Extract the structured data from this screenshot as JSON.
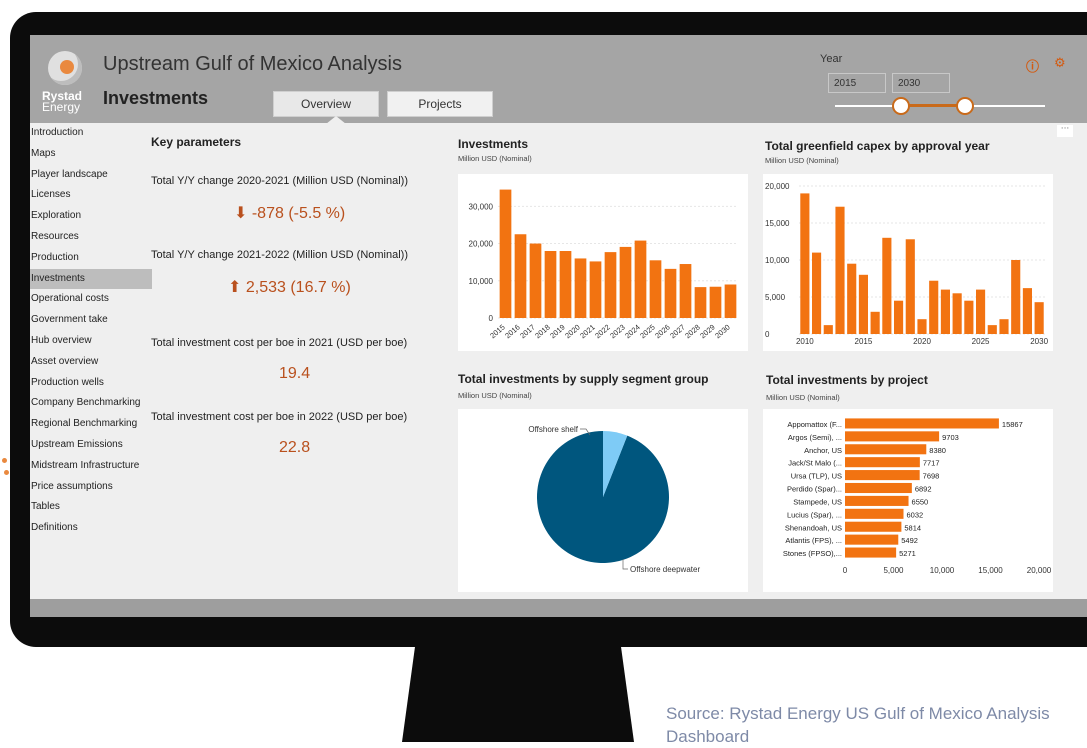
{
  "header": {
    "logo_top": "Rystad",
    "logo_bottom": "Energy",
    "app_title": "Upstream Gulf of Mexico Analysis",
    "page_title": "Investments",
    "tabs": [
      {
        "label": "Overview",
        "active": true
      },
      {
        "label": "Projects",
        "active": false
      }
    ],
    "year_label": "Year",
    "year_from": "2015",
    "year_to": "2030",
    "info_icon": "info-icon",
    "settings_icon": "gear-icon",
    "more_label": "···"
  },
  "nav": {
    "items": [
      "Introduction",
      "Maps",
      "Player landscape",
      "Licenses",
      "Exploration",
      "Resources",
      "Production",
      "Investments",
      "Operational costs",
      "Government take",
      "Hub overview",
      "Asset overview",
      "Production wells",
      "Company Benchmarking",
      "Regional Benchmarking",
      "Upstream Emissions",
      "Midstream Infrastructure",
      "Price assumptions",
      "Tables",
      "Definitions"
    ],
    "active_index": 7
  },
  "key_parameters": {
    "title": "Key parameters",
    "kpis": [
      {
        "label": "Total Y/Y change 2020-2021 (Million USD (Nominal))",
        "value": "⬇ -878 (-5.5 %)"
      },
      {
        "label": "Total Y/Y change 2021-2022 (Million USD (Nominal))",
        "value": "⬆ 2,533 (16.7 %)"
      },
      {
        "label": "Total investment cost per boe in 2021 (USD per boe)",
        "value": "19.4"
      },
      {
        "label": "Total investment cost per boe in 2022 (USD per boe)",
        "value": "22.8"
      }
    ]
  },
  "panels": {
    "investments": {
      "title": "Investments",
      "subtitle": "Million USD (Nominal)"
    },
    "greenfield": {
      "title": "Total greenfield capex by approval year",
      "subtitle": "Million USD (Nominal)"
    },
    "segment": {
      "title": "Total investments by supply segment group",
      "subtitle": "Million USD (Nominal)"
    },
    "project": {
      "title": "Total investments by project",
      "subtitle": "Million USD (Nominal)"
    }
  },
  "colors": {
    "bar": "#f27311",
    "deepwater": "#00567e",
    "shelf": "#7ecbf6",
    "accent": "#b9501d"
  },
  "chart_data": [
    {
      "type": "bar",
      "title": "Investments",
      "subtitle": "Million USD (Nominal)",
      "categories": [
        "2015",
        "2016",
        "2017",
        "2018",
        "2019",
        "2020",
        "2021",
        "2022",
        "2023",
        "2024",
        "2025",
        "2026",
        "2027",
        "2028",
        "2029",
        "2030"
      ],
      "values": [
        34500,
        22500,
        20000,
        18000,
        18000,
        16000,
        15200,
        17700,
        19100,
        20800,
        15500,
        13200,
        14500,
        8300,
        8400,
        9000
      ],
      "ylim": [
        0,
        36000
      ],
      "yticks": [
        "0",
        "10,000",
        "20,000",
        "30,000"
      ],
      "ytick_values": [
        0,
        10000,
        20000,
        30000
      ]
    },
    {
      "type": "bar",
      "title": "Total greenfield capex by approval year",
      "subtitle": "Million USD (Nominal)",
      "x": [
        2010,
        2011,
        2012,
        2013,
        2014,
        2015,
        2016,
        2017,
        2018,
        2019,
        2020,
        2021,
        2022,
        2023,
        2024,
        2025,
        2026,
        2027,
        2028,
        2029,
        2030
      ],
      "values": [
        19000,
        11000,
        1200,
        17200,
        9500,
        8000,
        3000,
        13000,
        4500,
        12800,
        2000,
        7200,
        6000,
        5500,
        4500,
        6000,
        1200,
        2000,
        10000,
        6200,
        4300
      ],
      "ylim": [
        0,
        20000
      ],
      "yticks": [
        "0",
        "5,000",
        "10,000",
        "15,000",
        "20,000"
      ],
      "ytick_values": [
        0,
        5000,
        10000,
        15000,
        20000
      ],
      "xticks": [
        "2010",
        "2015",
        "2020",
        "2025",
        "2030"
      ],
      "xtick_values": [
        2010,
        2015,
        2020,
        2025,
        2030
      ]
    },
    {
      "type": "pie",
      "title": "Total investments by supply segment group",
      "subtitle": "Million USD (Nominal)",
      "slices": [
        {
          "label": "Offshore deepwater",
          "value": 94
        },
        {
          "label": "Offshore shelf",
          "value": 6
        }
      ]
    },
    {
      "type": "bar",
      "orientation": "horizontal",
      "title": "Total investments by project",
      "subtitle": "Million USD (Nominal)",
      "categories": [
        "Appomattox (F...",
        "Argos (Semi), ...",
        "Anchor, US",
        "Jack/St Malo (...",
        "Ursa (TLP), US",
        "Perdido (Spar)...",
        "Stampede, US",
        "Lucius (Spar), ...",
        "Shenandoah, US",
        "Atlantis (FPS), ...",
        "Stones (FPSO),..."
      ],
      "values": [
        15867,
        9703,
        8380,
        7717,
        7698,
        6892,
        6550,
        6032,
        5814,
        5492,
        5271
      ],
      "data_labels": [
        "15867",
        "9703",
        "8380",
        "7717",
        "7698",
        "6892",
        "6550",
        "6032",
        "5814",
        "5492",
        "5271"
      ],
      "xlim": [
        0,
        20000
      ],
      "xticks": [
        "0",
        "5,000",
        "10,000",
        "15,000",
        "20,000"
      ],
      "xtick_values": [
        0,
        5000,
        10000,
        15000,
        20000
      ]
    }
  ],
  "source": "Source: Rystad Energy US Gulf of Mexico Analysis Dashboard"
}
